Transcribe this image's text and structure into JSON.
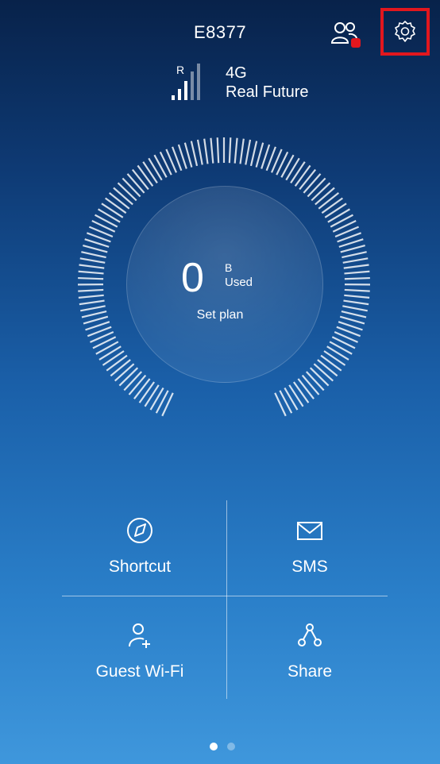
{
  "header": {
    "device_name": "E8377",
    "users_badge_color": "#e2171e"
  },
  "status": {
    "roaming": "R",
    "network_type": "4G",
    "operator": "Real Future",
    "signal_bars": 3
  },
  "usage": {
    "value": "0",
    "unit": "B",
    "label": "Used",
    "action": "Set plan"
  },
  "shortcuts": [
    {
      "label": "Shortcut",
      "icon": "compass-icon"
    },
    {
      "label": "SMS",
      "icon": "envelope-icon"
    },
    {
      "label": "Guest Wi-Fi",
      "icon": "add-user-icon"
    },
    {
      "label": "Share",
      "icon": "share-icon"
    }
  ],
  "pager": {
    "pages": 2,
    "current": 1
  },
  "colors": {
    "highlight": "#e2171e"
  }
}
